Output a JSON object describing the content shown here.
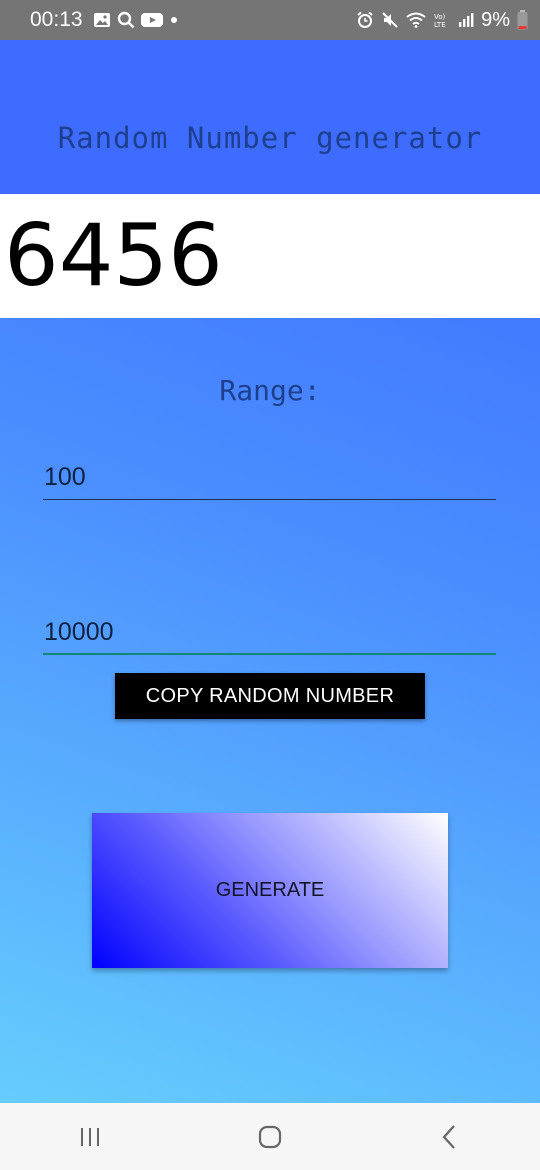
{
  "status_bar": {
    "time": "00:13",
    "battery_text": "9%",
    "left_icons": [
      "gallery-icon",
      "search-icon",
      "youtube-icon",
      "dot-icon"
    ],
    "right_icons": [
      "alarm-icon",
      "mute-icon",
      "wifi-icon",
      "volte-icon",
      "signal-icon",
      "battery-icon"
    ],
    "volte_label": "Vo) LTE"
  },
  "app": {
    "title": "Random Number generator",
    "result": "6456",
    "range_label": "Range:",
    "min_value": "100",
    "max_value": "10000",
    "copy_button_label": "COPY RANDOM NUMBER",
    "generate_button_label": "GENERATE"
  },
  "nav_bar": {
    "buttons": [
      "recent-apps-icon",
      "home-icon",
      "back-icon"
    ]
  },
  "colors": {
    "title_bar": "#3d6cff",
    "text_dark_blue": "#1e3f8e",
    "max_field_underline": "#14857a"
  }
}
